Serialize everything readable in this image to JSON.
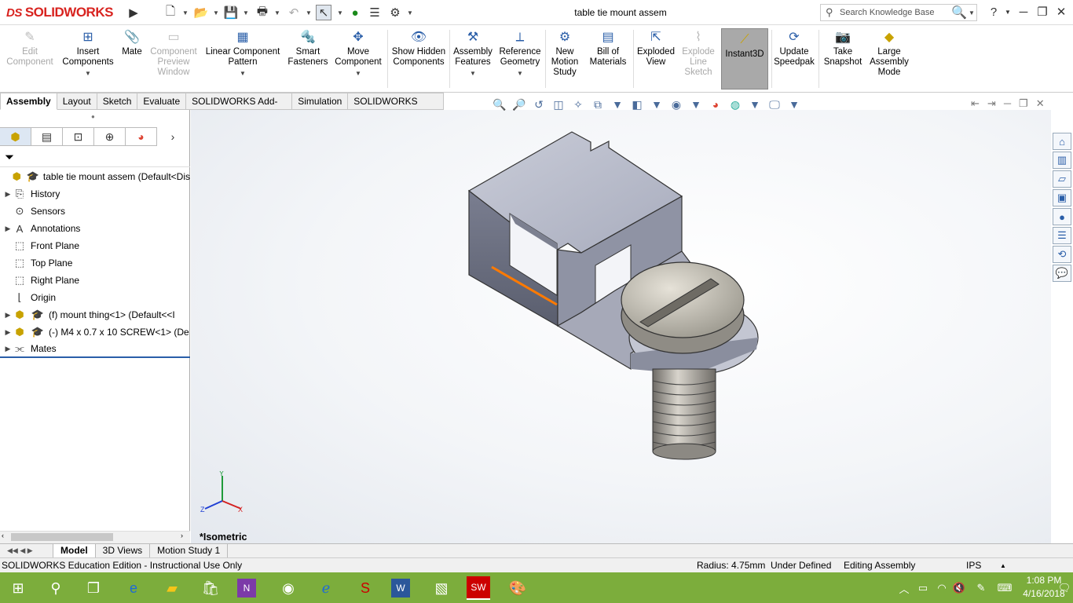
{
  "app": {
    "brand": "SOLIDWORKS",
    "brand_prefix": "DS"
  },
  "window": {
    "title": "table tie mount assem"
  },
  "search": {
    "label": "Search Knowledge Base"
  },
  "commands": [
    {
      "label": "Edit Component",
      "icon": "edit-component-icon",
      "disabled": true
    },
    {
      "label": "Insert Components",
      "icon": "insert-components-icon",
      "disabled": false
    },
    {
      "label": "Mate",
      "icon": "mate-icon",
      "disabled": false
    },
    {
      "label": "Component Preview Window",
      "icon": "preview-window-icon",
      "disabled": true
    },
    {
      "label": "Linear Component Pattern",
      "icon": "linear-pattern-icon",
      "disabled": false
    },
    {
      "label": "Smart Fasteners",
      "icon": "smart-fasteners-icon",
      "disabled": false
    },
    {
      "label": "Move Component",
      "icon": "move-component-icon",
      "disabled": false
    },
    {
      "label": "Show Hidden Components",
      "icon": "show-hidden-icon",
      "disabled": false
    },
    {
      "label": "Assembly Features",
      "icon": "assembly-features-icon",
      "disabled": false
    },
    {
      "label": "Reference Geometry",
      "icon": "reference-geometry-icon",
      "disabled": false
    },
    {
      "label": "New Motion Study",
      "icon": "motion-study-icon",
      "disabled": false
    },
    {
      "label": "Bill of Materials",
      "icon": "bom-icon",
      "disabled": false
    },
    {
      "label": "Exploded View",
      "icon": "exploded-view-icon",
      "disabled": false
    },
    {
      "label": "Explode Line Sketch",
      "icon": "explode-line-icon",
      "disabled": true
    },
    {
      "label": "Instant3D",
      "icon": "instant3d-icon",
      "active": true
    },
    {
      "label": "Update Speedpak",
      "icon": "speedpak-icon",
      "disabled": false
    },
    {
      "label": "Take Snapshot",
      "icon": "camera-icon",
      "disabled": false
    },
    {
      "label": "Large Assembly Mode",
      "icon": "large-assembly-icon",
      "disabled": false
    }
  ],
  "tabs": [
    "Assembly",
    "Layout",
    "Sketch",
    "Evaluate",
    "SOLIDWORKS Add-Ins",
    "Simulation",
    "SOLIDWORKS MBD"
  ],
  "tree": [
    {
      "label": "table tie mount assem  (Default<Dis",
      "icon": "assembly-icon",
      "expand": ""
    },
    {
      "label": "History",
      "icon": "history-icon",
      "expand": "▶"
    },
    {
      "label": "Sensors",
      "icon": "sensor-icon",
      "expand": ""
    },
    {
      "label": "Annotations",
      "icon": "annotation-icon",
      "expand": "▶"
    },
    {
      "label": "Front Plane",
      "icon": "plane-icon",
      "expand": ""
    },
    {
      "label": "Top Plane",
      "icon": "plane-icon",
      "expand": ""
    },
    {
      "label": "Right Plane",
      "icon": "plane-icon",
      "expand": ""
    },
    {
      "label": "Origin",
      "icon": "origin-icon",
      "expand": ""
    },
    {
      "label": "(f) mount thing<1> (Default<<I",
      "icon": "part-icon",
      "expand": "▶"
    },
    {
      "label": "(-) M4 x 0.7 x 10 SCREW<1> (De",
      "icon": "part-icon",
      "expand": "▶"
    },
    {
      "label": "Mates",
      "icon": "mates-icon",
      "expand": "▶"
    }
  ],
  "viewport": {
    "orientation": "*Isometric"
  },
  "bottom_tabs": [
    "Model",
    "3D Views",
    "Motion Study 1"
  ],
  "status": {
    "edition": "SOLIDWORKS Education Edition - Instructional Use Only",
    "radius": "Radius: 4.75mm",
    "state": "Under Defined",
    "mode": "Editing Assembly",
    "units": "IPS"
  },
  "clock": {
    "time": "1:08 PM",
    "date": "4/16/2018"
  },
  "colors": {
    "brand": "#d8231f",
    "taskbar": "#7cad3c",
    "active_cmd": "#a9a9a9"
  }
}
